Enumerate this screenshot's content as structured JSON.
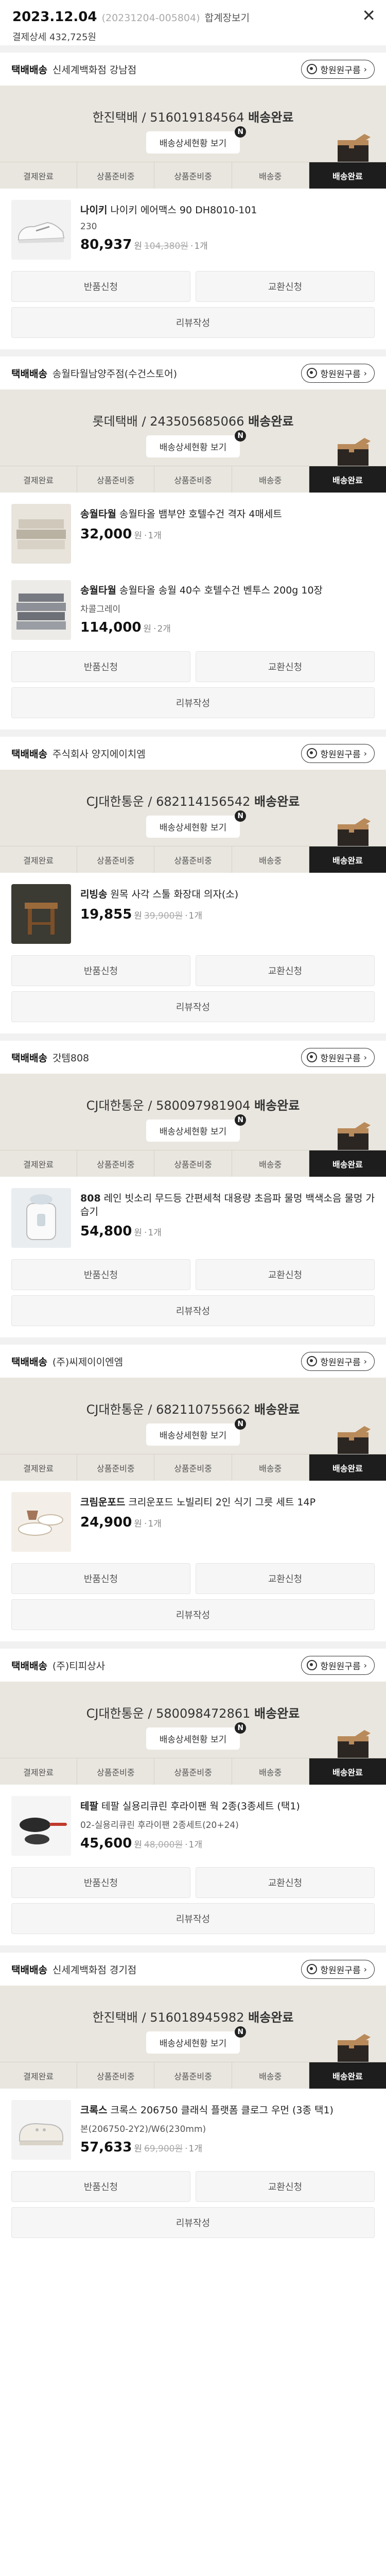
{
  "header": {
    "date": "2023.12.04",
    "order_no": "(20231204-005804)",
    "merge_label": "합계장보기",
    "payment_label": "결제상세",
    "payment_amount": "432,725원",
    "close_symbol": "✕"
  },
  "common": {
    "location_button": "항원원구름",
    "tracking_button": "배송상세현황 보기",
    "badge": "N",
    "done_label": "배송완료",
    "won": "원",
    "qty_sep": "·",
    "buttons": {
      "return": "반품신청",
      "exchange": "교환신청",
      "review": "리뷰작성"
    },
    "steps": [
      "결제완료",
      "상품준비중",
      "상품준비중",
      "배송중",
      "배송완료"
    ]
  },
  "colors": {
    "status_bg": "#e9e6df",
    "active_step": "#1d1d1d",
    "page_bg": "#ffffff"
  },
  "shipments": [
    {
      "type": "택배배송",
      "seller": "신세계백화점 강남점",
      "carrier": "한진택배 / 516019184564",
      "items": [
        {
          "brand": "나이키",
          "name": "나이키 에어맥스 90 DH8010-101",
          "option": "230",
          "price": "80,937",
          "original": "104,380원",
          "qty": "1개",
          "thumb": "sneaker-thumbnail"
        }
      ]
    },
    {
      "type": "택배배송",
      "seller": "송월타월남양주점(수건스토어)",
      "carrier": "롯데택배 / 243505685066",
      "items": [
        {
          "brand": "송월타월",
          "name": "송월타올 뱀부얀 호텔수건 격자 4매세트",
          "option": "",
          "price": "32,000",
          "original": "",
          "qty": "1개",
          "thumb": "towel-thumbnail"
        },
        {
          "brand": "송월타월",
          "name": "송월타올 송월 40수 호텔수건 벤투스 200g 10장",
          "option": "차콜그레이",
          "price": "114,000",
          "original": "",
          "qty": "2개",
          "thumb": "towel-stack-thumbnail"
        }
      ]
    },
    {
      "type": "택배배송",
      "seller": "주식회사 양지에이치엠",
      "carrier": "CJ대한통운 / 682114156542",
      "items": [
        {
          "brand": "리빙송",
          "name": "원목 사각 스툴 화장대 의자(소)",
          "option": "",
          "price": "19,855",
          "original": "39,900원",
          "qty": "1개",
          "thumb": "stool-thumbnail"
        }
      ]
    },
    {
      "type": "택배배송",
      "seller": "갓템808",
      "carrier": "CJ대한통운 / 580097981904",
      "items": [
        {
          "brand": "808",
          "name": "레인 빗소리 무드등 간편세척 대용량 초음파 물멍 백색소음 물멍 가습기",
          "option": "",
          "price": "54,800",
          "original": "",
          "qty": "1개",
          "thumb": "humidifier-thumbnail"
        }
      ]
    },
    {
      "type": "택배배송",
      "seller": "(주)씨제이이엔엠",
      "carrier": "CJ대한통운 / 682110755662",
      "items": [
        {
          "brand": "크림운포드",
          "name": "크리운포드 노빌리티 2인 식기 그릇 세트 14P",
          "option": "",
          "price": "24,900",
          "original": "",
          "qty": "1개",
          "thumb": "dish-set-thumbnail"
        }
      ]
    },
    {
      "type": "택배배송",
      "seller": "(주)티피상사",
      "carrier": "CJ대한통운 / 580098472861",
      "items": [
        {
          "brand": "테팔",
          "name": "테팔 실용리큐린 후라이팬 웍 2종(3종세트 (택1)",
          "option": "02-실용리큐린 후라이팬 2종세트(20+24)",
          "price": "45,600",
          "original": "48,000원",
          "qty": "1개",
          "thumb": "frypan-thumbnail"
        }
      ]
    },
    {
      "type": "택배배송",
      "seller": "신세계백화점 경기점",
      "carrier": "한진택배 / 516018945982",
      "items": [
        {
          "brand": "크록스",
          "name": "크록스 206750 클래식 플랫폼 클로그 우먼 (3종 택1)",
          "option": "본(206750-2Y2)/W6(230mm)",
          "price": "57,633",
          "original": "69,900원",
          "qty": "1개",
          "thumb": "clog-thumbnail"
        }
      ]
    }
  ]
}
